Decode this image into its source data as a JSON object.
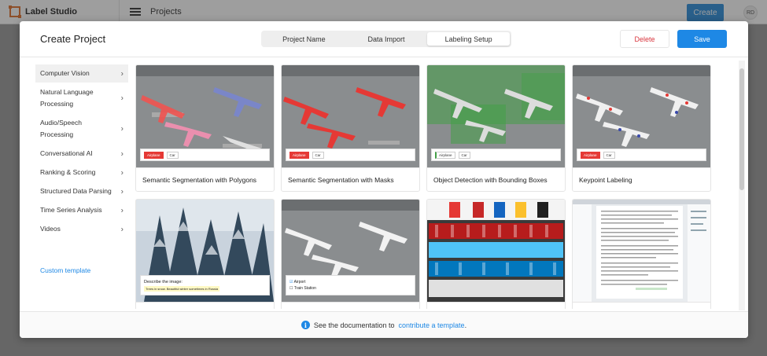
{
  "app": {
    "name": "Label Studio",
    "breadcrumb": "Projects",
    "create_label": "Create",
    "avatar_initials": "RD"
  },
  "modal": {
    "title": "Create Project",
    "tabs": [
      {
        "label": "Project Name",
        "active": false
      },
      {
        "label": "Data Import",
        "active": false
      },
      {
        "label": "Labeling Setup",
        "active": true
      }
    ],
    "delete_label": "Delete",
    "save_label": "Save"
  },
  "sidebar": {
    "items": [
      {
        "label": "Computer Vision",
        "active": true
      },
      {
        "label": "Natural Language Processing",
        "active": false
      },
      {
        "label": "Audio/Speech Processing",
        "active": false
      },
      {
        "label": "Conversational AI",
        "active": false
      },
      {
        "label": "Ranking & Scoring",
        "active": false
      },
      {
        "label": "Structured Data Parsing",
        "active": false
      },
      {
        "label": "Time Series Analysis",
        "active": false
      },
      {
        "label": "Videos",
        "active": false
      }
    ],
    "custom_template": "Custom template"
  },
  "templates": [
    {
      "label": "Semantic Segmentation with Polygons",
      "chips": [
        "Airplane",
        "Car"
      ]
    },
    {
      "label": "Semantic Segmentation with Masks",
      "chips": [
        "Airplane",
        "Car"
      ]
    },
    {
      "label": "Object Detection with Bounding Boxes",
      "chips": [
        "Airplane",
        "Car"
      ]
    },
    {
      "label": "Keypoint Labeling",
      "chips": [
        "Airplane",
        "Car"
      ]
    },
    {
      "label": "",
      "prompt": "Describe the image:",
      "answer": "Trees in snow. Beautiful winter sometimes in Russia"
    },
    {
      "label": "",
      "options": [
        "Airport",
        "Train Station"
      ]
    },
    {
      "label": ""
    },
    {
      "label": ""
    }
  ],
  "footer": {
    "prefix": "See the documentation to",
    "link": "contribute a template",
    "suffix": "."
  },
  "colors": {
    "accent": "#1e88e5",
    "danger": "#d9363e",
    "logo": "#e0702d"
  },
  "icons": [
    "hamburger-icon",
    "chevron-right-icon",
    "info-icon"
  ]
}
